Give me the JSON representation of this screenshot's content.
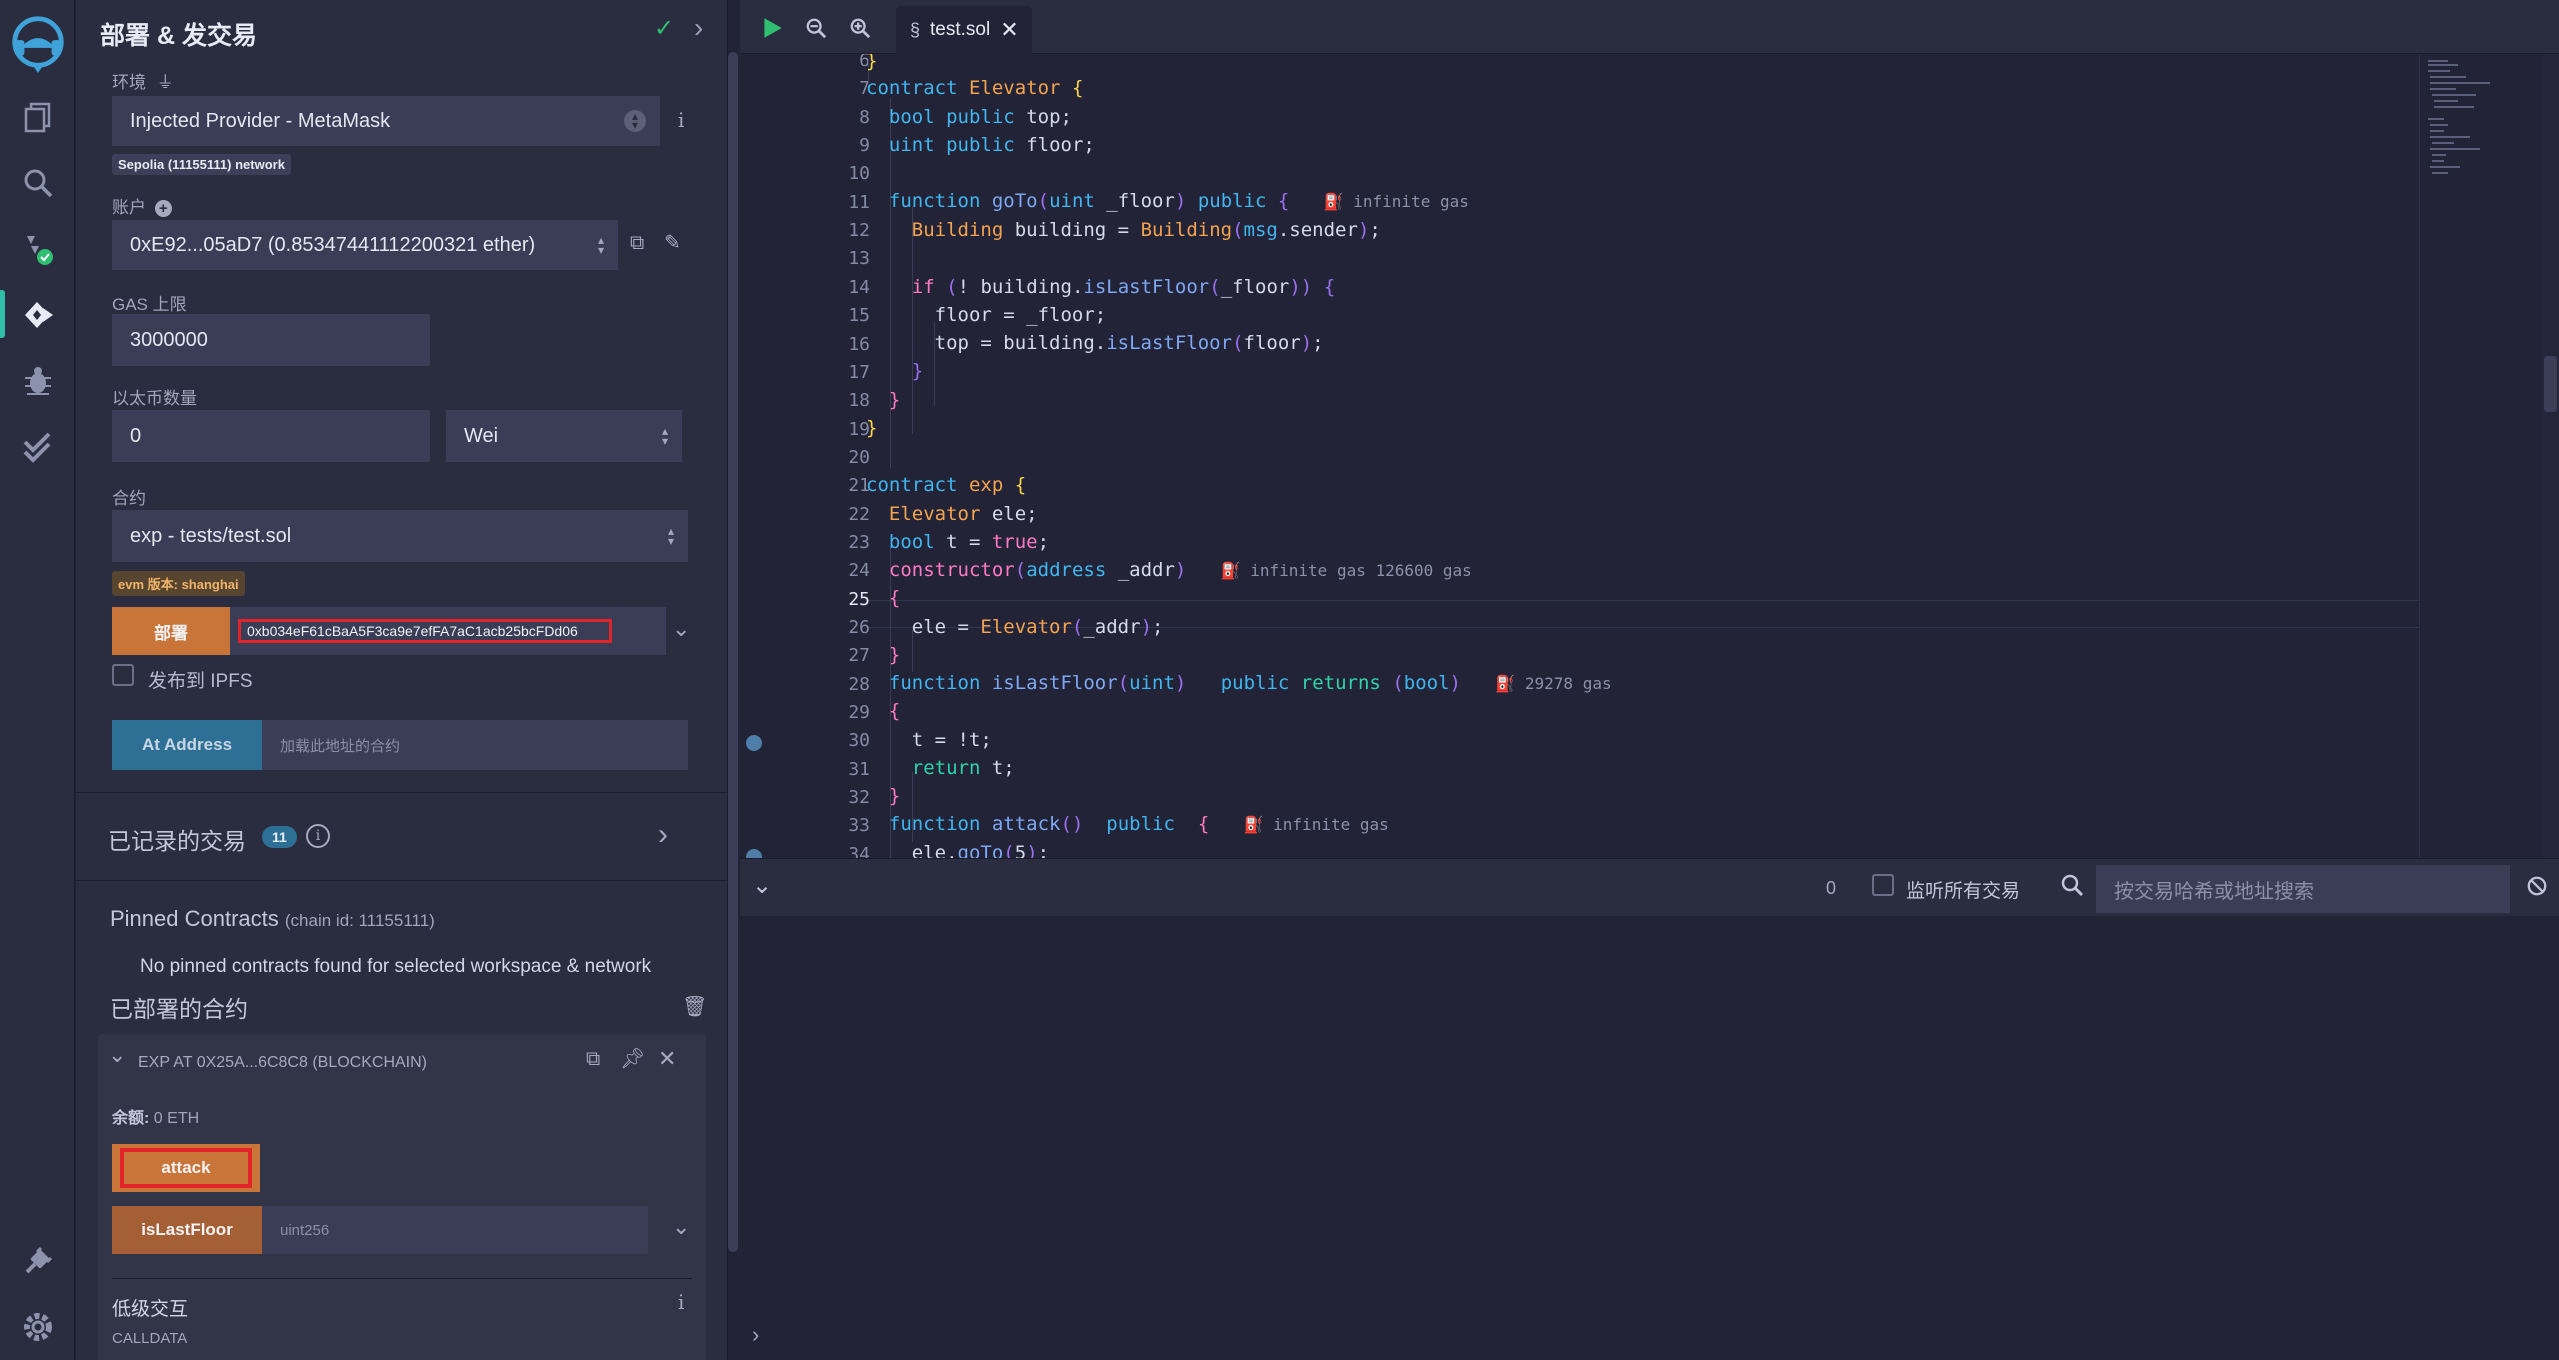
{
  "rail": {
    "icons": [
      "remix-logo-icon",
      "file-explorer-icon",
      "search-icon",
      "solidity-compiler-icon",
      "deploy-run-icon",
      "debugger-icon",
      "unit-testing-icon",
      "plugin-manager-icon",
      "settings-icon"
    ]
  },
  "panel": {
    "title": "部署 & 发交易",
    "environment": {
      "label": "环境",
      "value": "Injected Provider - MetaMask",
      "network_badge": "Sepolia (11155111) network"
    },
    "account": {
      "label": "账户",
      "value": "0xE92...05aD7 (0.85347441112200321 ether)"
    },
    "gas_limit": {
      "label": "GAS 上限",
      "value": "3000000"
    },
    "value": {
      "label": "以太币数量",
      "amount": "0",
      "unit": "Wei"
    },
    "contract": {
      "label": "合约",
      "value": "exp - tests/test.sol",
      "evm_badge": "evm 版本: shanghai"
    },
    "deploy": {
      "button": "部署",
      "arg_value": "0xb034eF61cBaA5F3ca9e7efFA7aC1acb25bcFDd06"
    },
    "publish_ipfs": "发布到 IPFS",
    "at_address": {
      "button": "At Address",
      "placeholder": "加载此地址的合约"
    },
    "recorded": {
      "label": "已记录的交易",
      "count": "11"
    },
    "pinned": {
      "title": "Pinned Contracts",
      "chain": "(chain id: 11155111)",
      "empty": "No pinned contracts found for selected workspace & network"
    },
    "deployed": {
      "title": "已部署的合约",
      "instance": "EXP AT 0X25A...6C8C8 (BLOCKCHAIN)",
      "balance_label": "余额:",
      "balance_value": "0 ETH",
      "attack_button": "attack",
      "islastfloor_button": "isLastFloor",
      "islastfloor_placeholder": "uint256",
      "low_level": "低级交互",
      "calldata": "CALLDATA"
    }
  },
  "editor": {
    "tab": "test.sol",
    "line_numbers": [
      "6",
      "7",
      "8",
      "9",
      "10",
      "11",
      "12",
      "13",
      "14",
      "15",
      "16",
      "17",
      "18",
      "19",
      "20",
      "21",
      "22",
      "23",
      "24",
      "25",
      "26",
      "27",
      "28",
      "29",
      "30",
      "31",
      "32",
      "33",
      "34"
    ],
    "active_line": "25",
    "gas_annotations": {
      "goto": "infinite gas",
      "constructor": "infinite gas 126600 gas",
      "islastfloor": "29278 gas",
      "attack": "infinite gas"
    }
  },
  "terminal": {
    "pending": "0",
    "listen_all": "监听所有交易",
    "search_placeholder": "按交易哈希或地址搜索"
  },
  "colors": {
    "accent_orange": "#c97539",
    "accent_blue": "#2e6f96",
    "teal": "#2fbfa8",
    "highlight_red": "#e0242a"
  }
}
